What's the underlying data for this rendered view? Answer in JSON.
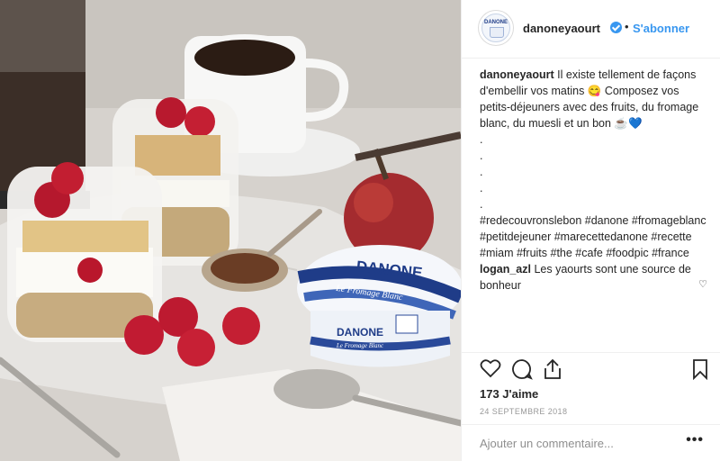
{
  "post": {
    "header": {
      "avatar_brand": "DANONE",
      "username": "danoneyaourt",
      "separator": "•",
      "follow_label": "S'abonner"
    },
    "caption": {
      "username": "danoneyaourt",
      "text": "Il existe tellement de façons d'embellir vos matins 😋 Composez vos petits-déjeuners avec des fruits, du fromage blanc, du muesli et un bon ☕💙",
      "dots": [
        ".",
        ".",
        ".",
        ".",
        "."
      ],
      "hashtags": "#redecouvronslebon #danone #fromageblanc #petitdejeuner #marecettedanone #recette #miam #fruits #the #cafe #foodpic #france"
    },
    "comment": {
      "username": "logan_azl",
      "text": "Les yaourts sont une source de bonheur"
    },
    "photo": {
      "brand_top": "DANONE",
      "product_top": "Le Fromage Blanc",
      "brand_bottom": "DANONE",
      "product_bottom": "Le Fromage Blanc"
    },
    "likes": "173 J'aime",
    "date": "24 SEPTEMBRE 2018",
    "add_comment_placeholder": "Ajouter un commentaire...",
    "more_label": "•••",
    "comment_like_icon": "♡"
  },
  "colors": {
    "link": "#3897f0",
    "text": "#262626",
    "muted": "#8e8e8e",
    "verified": "#3897f0"
  },
  "icons": [
    "heart-icon",
    "comment-icon",
    "share-icon",
    "bookmark-icon",
    "verified-badge-icon"
  ]
}
